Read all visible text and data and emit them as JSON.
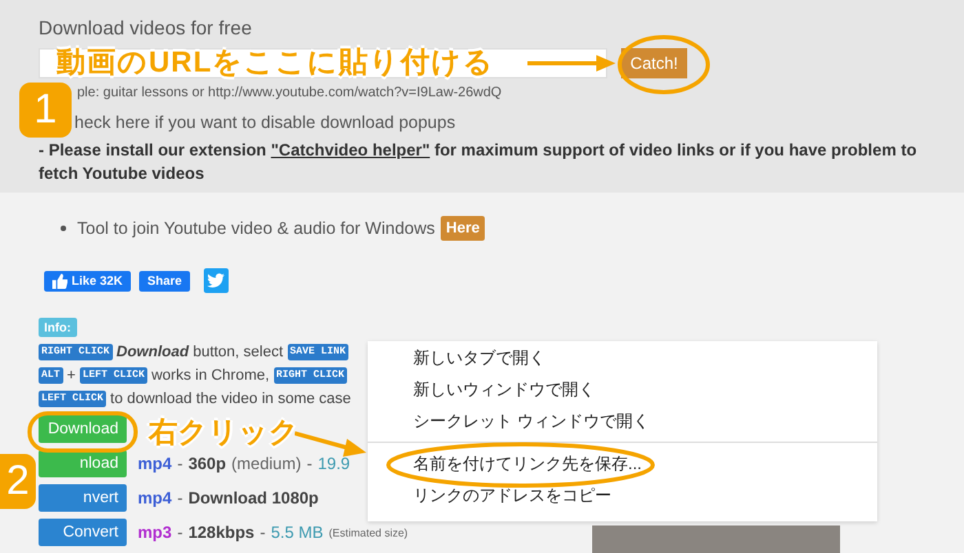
{
  "header": {
    "title": "Download videos for free",
    "catch_button": "Catch!",
    "example": "ple: guitar lessons or http://www.youtube.com/watch?v=I9Law-26wdQ",
    "popup_note": "heck here if you want to disable download popups"
  },
  "notice": {
    "before": "- Please install our extension ",
    "link": "\"Catchvideo helper\"",
    "after": " for maximum support of video links or if you have problem to fetch Youtube videos"
  },
  "tool_line": {
    "text": "Tool to join Youtube video & audio for Windows",
    "button": "Here"
  },
  "social": {
    "like": "Like 32K",
    "share": "Share"
  },
  "info": {
    "badge": "Info:",
    "lines": [
      [
        {
          "kind": "key",
          "text": "RIGHT CLICK"
        },
        {
          "kind": "em",
          "text": "Download"
        },
        {
          "kind": "text",
          "text": "button, select"
        },
        {
          "kind": "key",
          "text": "SAVE LINK"
        }
      ],
      [
        {
          "kind": "key",
          "text": "ALT"
        },
        {
          "kind": "text",
          "text": "+"
        },
        {
          "kind": "key",
          "text": "LEFT CLICK"
        },
        {
          "kind": "text",
          "text": "works in Chrome,"
        },
        {
          "kind": "key",
          "text": "RIGHT CLICK"
        }
      ],
      [
        {
          "kind": "key",
          "text": "LEFT CLICK"
        },
        {
          "kind": "text",
          "text": "to download the video in some case"
        }
      ]
    ]
  },
  "formats": [
    {
      "button": "Download",
      "kind": "download"
    },
    {
      "button": "nload",
      "kind": "download",
      "parts": [
        {
          "kind": "format",
          "text": "mp4",
          "color": "#3d5fd6"
        },
        {
          "kind": "sep",
          "text": "-"
        },
        {
          "kind": "quality",
          "text": "360p"
        },
        {
          "kind": "note",
          "text": "(medium)"
        },
        {
          "kind": "sep",
          "text": "-"
        },
        {
          "kind": "size",
          "text": "19.9"
        }
      ]
    },
    {
      "button": "nvert",
      "kind": "convert",
      "parts": [
        {
          "kind": "format",
          "text": "mp4",
          "color": "#3d5fd6"
        },
        {
          "kind": "sep",
          "text": "-"
        },
        {
          "kind": "quality",
          "text": "Download 1080p"
        }
      ]
    },
    {
      "button": "Convert",
      "kind": "convert",
      "parts": [
        {
          "kind": "format",
          "text": "mp3",
          "color": "#b12fd0"
        },
        {
          "kind": "sep",
          "text": "-"
        },
        {
          "kind": "quality",
          "text": "128kbps"
        },
        {
          "kind": "sep",
          "text": "-"
        },
        {
          "kind": "size",
          "text": "5.5 MB"
        },
        {
          "kind": "small",
          "text": "(Estimated size)"
        }
      ]
    }
  ],
  "context_menu": {
    "items": [
      {
        "label": "新しいタブで開く",
        "divider_before": false
      },
      {
        "label": "新しいウィンドウで開く",
        "divider_before": false
      },
      {
        "label": "シークレット ウィンドウで開く",
        "divider_before": false
      },
      {
        "label": "名前を付けてリンク先を保存...",
        "divider_before": true
      },
      {
        "label": "リンクのアドレスをコピー",
        "divider_before": false
      }
    ]
  },
  "annotations": {
    "paste_hint": "動画のURLをここに貼り付ける",
    "step_1": "1",
    "right_click_hint": "右クリック",
    "step_2": "2"
  }
}
